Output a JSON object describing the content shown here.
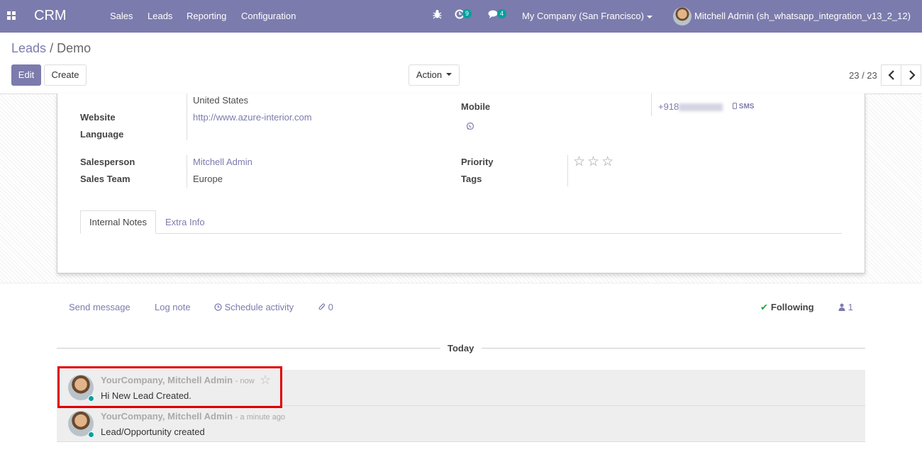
{
  "navbar": {
    "brand": "CRM",
    "menu": [
      "Sales",
      "Leads",
      "Reporting",
      "Configuration"
    ],
    "activity_count": "9",
    "message_count": "4",
    "company": "My Company (San Francisco)",
    "user": "Mitchell Admin (sh_whatsapp_integration_v13_2_12)"
  },
  "breadcrumb": {
    "parent": "Leads",
    "separator": "/",
    "current": "Demo"
  },
  "toolbar": {
    "edit": "Edit",
    "create": "Create",
    "action": "Action"
  },
  "pager": {
    "value": "23 / 23"
  },
  "form": {
    "country": "United States",
    "website_label": "Website",
    "website": "http://www.azure-interior.com",
    "language_label": "Language",
    "mobile_label": "Mobile",
    "mobile_prefix": "+918",
    "sms": "SMS",
    "salesperson_label": "Salesperson",
    "salesperson": "Mitchell Admin",
    "sales_team_label": "Sales Team",
    "sales_team": "Europe",
    "priority_label": "Priority",
    "priority_stars": "☆☆☆",
    "tags_label": "Tags",
    "tabs": [
      "Internal Notes",
      "Extra Info"
    ]
  },
  "chatter": {
    "send_message": "Send message",
    "log_note": "Log note",
    "schedule_activity": "Schedule activity",
    "attachments": "0",
    "following": "Following",
    "followers": "1",
    "date_separator": "Today",
    "messages": [
      {
        "author": "YourCompany, Mitchell Admin",
        "time": "- now",
        "body": "Hi New Lead Created."
      },
      {
        "author": "YourCompany, Mitchell Admin",
        "time": "- a minute ago",
        "body": "Lead/Opportunity created"
      }
    ]
  }
}
